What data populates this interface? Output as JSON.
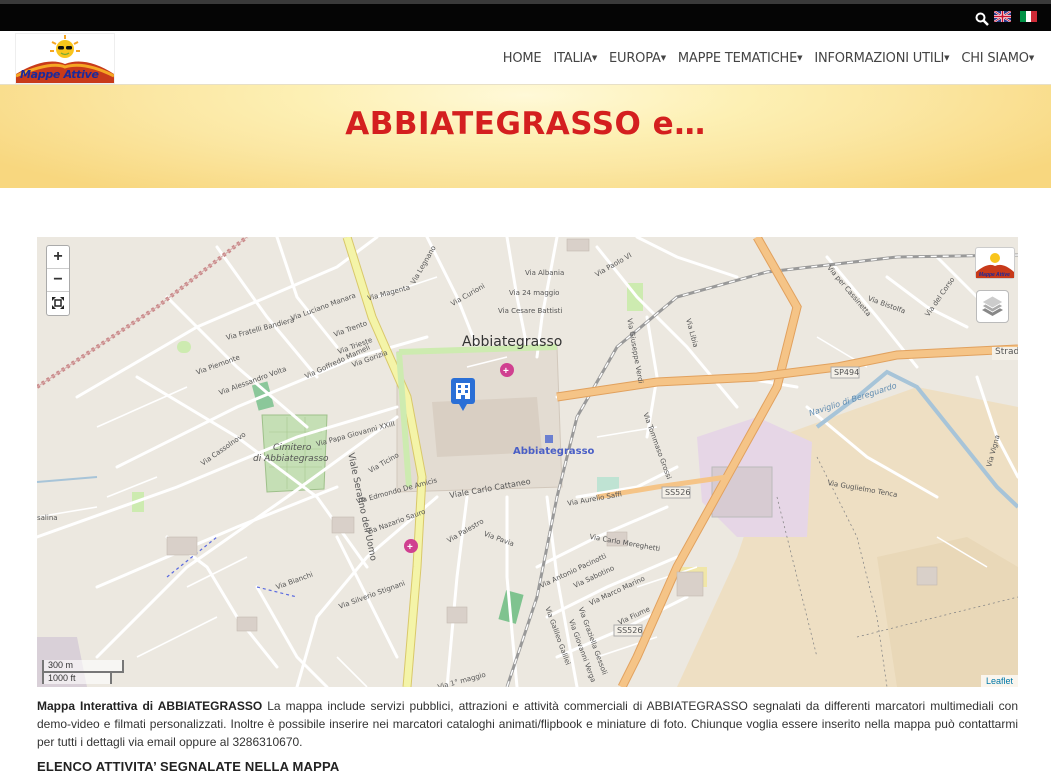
{
  "header": {
    "logo_text": "Mappe Attive",
    "menu": [
      {
        "label": "HOME",
        "dropdown": false
      },
      {
        "label": "ITALIA",
        "dropdown": true
      },
      {
        "label": "EUROPA",
        "dropdown": true
      },
      {
        "label": "MAPPE TEMATICHE",
        "dropdown": true
      },
      {
        "label": "INFORMAZIONI UTILI",
        "dropdown": true
      },
      {
        "label": "CHI SIAMO",
        "dropdown": true
      }
    ],
    "icons": [
      "search-icon",
      "flag-uk-icon",
      "flag-it-icon"
    ]
  },
  "hero": {
    "title": "ABBIATEGRASSO e…"
  },
  "map": {
    "zoom_in": "+",
    "zoom_out": "−",
    "scale_metric": "300 m",
    "scale_imperial": "1000 ft",
    "attribution": "Leaflet",
    "labels": {
      "town": "Abbiategrasso",
      "station": "Abbiategrasso",
      "cemetery_1": "Cimitero",
      "cemetery_2": "di Abbiategrasso",
      "road_strada": "Strada",
      "sp494": "SP494",
      "ss526_a": "SS526",
      "ss526_b": "SS526",
      "naviglio": "Naviglio di Bereguardo",
      "viale_serafino": "Viale Serafino dell'Uomo",
      "viale_cattaneo": "Viale Carlo Cattaneo",
      "via_albania": "Via Albania",
      "via_24maggio": "Via 24 maggio",
      "via_battisti": "Via Cesare Battisti",
      "via_curioni": "Via Curioni",
      "via_magenta": "Via Magenta",
      "via_manara": "Via Luciano Manara",
      "via_trento": "Via Trento",
      "via_trieste": "Via Trieste",
      "via_gorizia": "Via Gorizia",
      "via_mameli": "Via Goffredo Mameli",
      "via_bandiera": "Via Fratelli Bandiera",
      "via_piemonte": "Via Piemonte",
      "via_volta": "Via Alessandro Volta",
      "via_cassolnovo": "Via Cassolnovo",
      "via_giovanni": "Via Papa Giovanni XXIII",
      "via_ticino": "Via Ticino",
      "via_amicis": "Via Edmondo De Amicis",
      "via_sauro": "Via Nazario Sauro",
      "via_palestro": "Via Palestro",
      "via_pavia": "Via Pavia",
      "via_saffi": "Via Aurelio Saffi",
      "via_mereghetti": "Via Carlo Mereghetti",
      "via_pacinotti": "Via Antonio Pacinotti",
      "via_sabotino": "Via Sabotino",
      "via_marino": "Via Marco Marino",
      "via_fiume": "Via Fiume",
      "via_tenca": "Via Guglielmo Tenca",
      "via_bistolfa": "Via Bistolfa",
      "via_corso": "Via del Corso",
      "via_vigna": "Via Vigna",
      "via_libia": "Via Libia",
      "via_paolo": "Via Paolo VI",
      "via_stignani": "Via Silverio Stignani",
      "via_bianchi": "Via Bianchi",
      "via_legnano": "Via Legnano",
      "via_1maggio": "Via 1° maggio",
      "via_verdi": "Via Giuseppe Verdi",
      "via_grossi": "Via Tommaso Grossi",
      "via_galilei": "Via Galileo Galilei",
      "via_verga": "Via Giovanni Verga",
      "via_gessoli": "Via Graziella Gessoli",
      "via_cantiere": "Via per Cassinetta",
      "via_salina": "salina"
    }
  },
  "description": {
    "bold_lead": "Mappa Interattiva di ABBIATEGRASSO",
    "text": " La mappa include servizi pubblici, attrazioni e attività commerciali di ABBIATEGRASSO segnalati da differenti marcatori multimediali con demo-video e filmati personalizzati. Inoltre è possibile inserire nei marcatori cataloghi animati/flipbook e miniature di foto. Chiunque voglia essere inserito nella mappa può contattarmi per tutti i dettagli via email oppure al 3286310670."
  },
  "section_title": "ELENCO ATTIVITA’ SEGNALATE NELLA MAPPA",
  "colors": {
    "hero_title": "#d41f1f",
    "topbar": "#050505",
    "map_bg": "#ece8e0",
    "main_road": "#f5c487",
    "serafino_road": "#f4f4a8",
    "park_green": "#cdebb0",
    "industrial": "#e6d6e6",
    "farmland": "#eedfc3"
  }
}
